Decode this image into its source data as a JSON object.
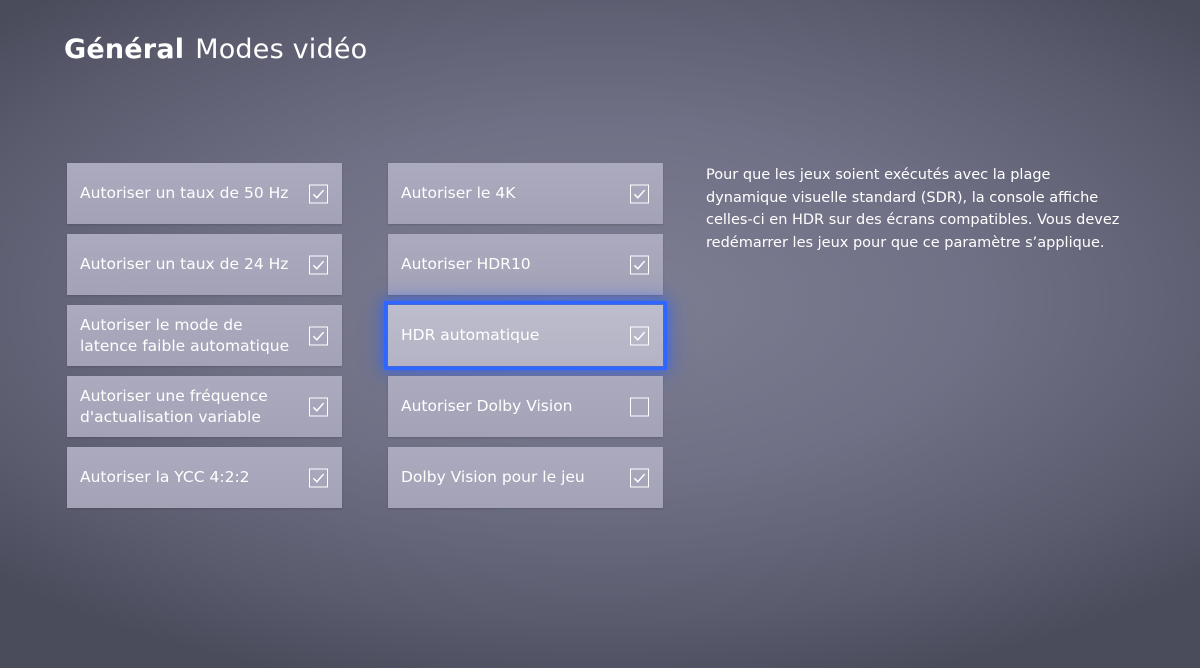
{
  "header": {
    "section": "Général",
    "page": "Modes vidéo"
  },
  "left_column": [
    {
      "label": "Autoriser un taux de 50 Hz",
      "checked": true
    },
    {
      "label": "Autoriser un taux de 24 Hz",
      "checked": true
    },
    {
      "label": "Autoriser le mode de latence faible automatique",
      "checked": true
    },
    {
      "label": "Autoriser une fréquence d'actualisation variable",
      "checked": true
    },
    {
      "label": "Autoriser la YCC 4:2:2",
      "checked": true
    }
  ],
  "right_column": [
    {
      "label": "Autoriser le 4K",
      "checked": true
    },
    {
      "label": "Autoriser HDR10",
      "checked": true
    },
    {
      "label": "HDR automatique",
      "checked": true,
      "focused": true
    },
    {
      "label": "Autoriser Dolby Vision",
      "checked": false
    },
    {
      "label": "Dolby Vision pour le jeu",
      "checked": true
    }
  ],
  "description": "Pour que les jeux soient exécutés avec la plage dynamique visuelle standard (SDR), la console affiche celles-ci en HDR sur des écrans compatibles. Vous devez redémarrer les jeux pour que ce paramètre s’applique.",
  "colors": {
    "focus_ring": "#2f66ff",
    "tile": "#a8a7bb",
    "background": "#6f7085"
  },
  "icons": {
    "checkbox": "checkmark-icon"
  }
}
